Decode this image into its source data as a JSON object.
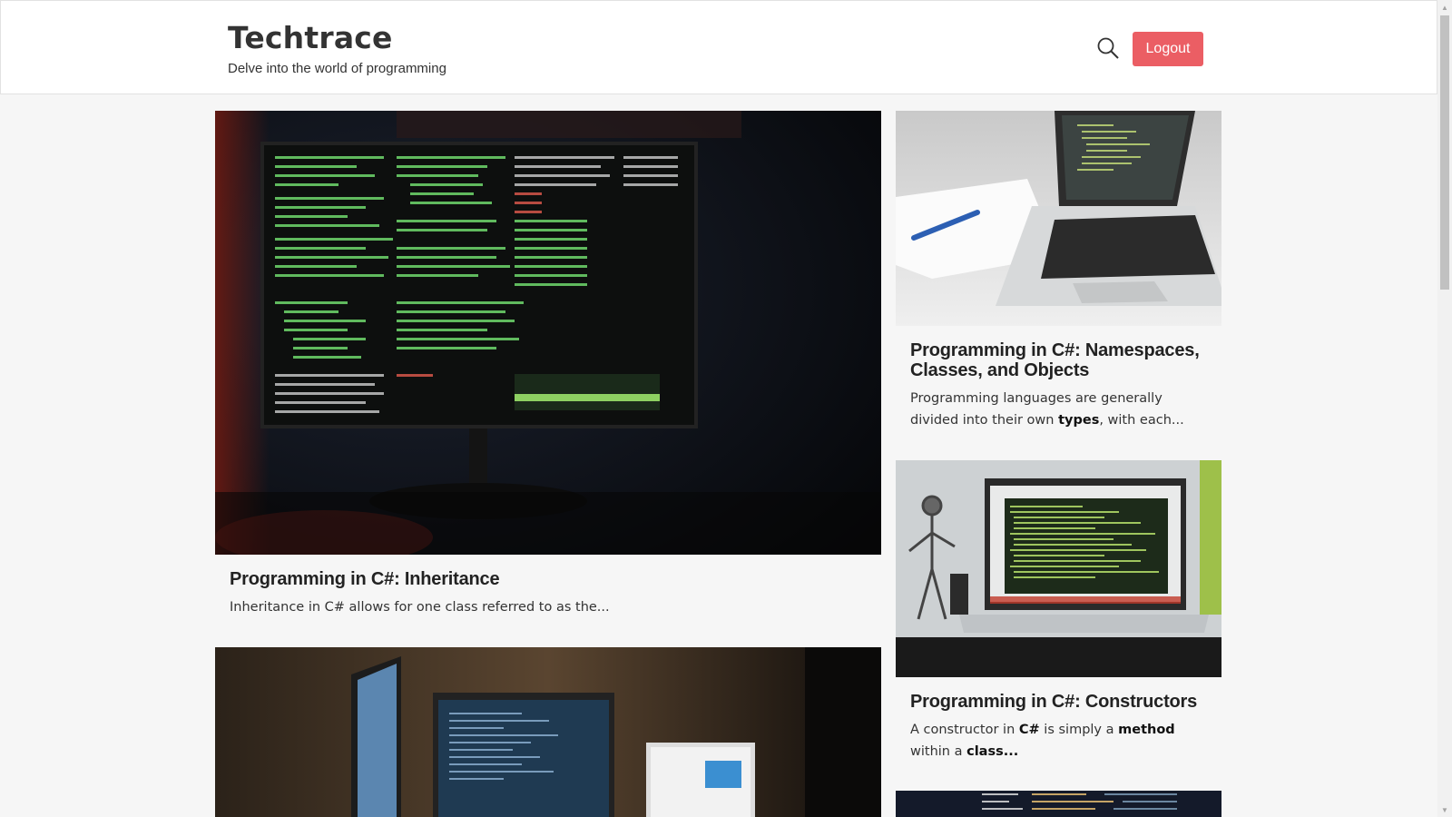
{
  "site": {
    "title": "Techtrace",
    "tagline": "Delve into the world of programming",
    "logout_label": "Logout",
    "accent_color": "#eb5e64"
  },
  "icons": {
    "search": "search-icon"
  },
  "posts": [
    {
      "title": "Programming in C#: Inheritance",
      "excerpt": "Inheritance in C# allows for one class referred to as the..."
    },
    {
      "title": "Programming in C#: Namespaces, Classes, and Objects",
      "excerpt_parts": [
        "Programming languages are generally divided into their own ",
        "types",
        ", with each..."
      ]
    },
    {
      "title": "Programming in C#: Constructors",
      "excerpt_parts": [
        "A constructor in ",
        "C#",
        " is simply a ",
        "method",
        " within a ",
        "class..."
      ]
    }
  ]
}
